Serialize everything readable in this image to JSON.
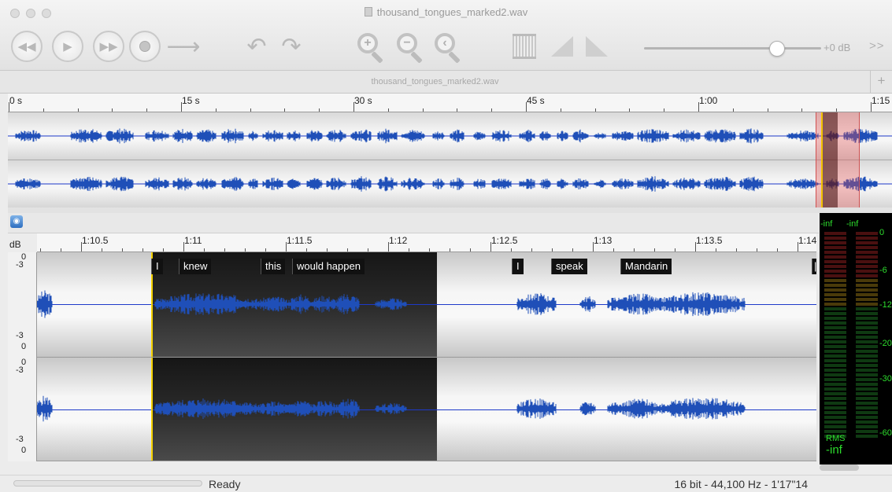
{
  "window": {
    "title": "thousand_tongues_marked2.wav"
  },
  "toolbar": {
    "buttons": [
      {
        "name": "rewind-button",
        "icon": "rewind-icon"
      },
      {
        "name": "play-button",
        "icon": "play-icon"
      },
      {
        "name": "fast-forward-button",
        "icon": "fast-forward-icon"
      },
      {
        "name": "record-button",
        "icon": "record-icon"
      },
      {
        "name": "loop-button",
        "icon": "arrow-right-icon"
      },
      {
        "name": "undo-button",
        "icon": "undo-icon"
      },
      {
        "name": "redo-button",
        "icon": "redo-icon"
      },
      {
        "name": "zoom-in-button",
        "icon": "zoom-in-icon"
      },
      {
        "name": "zoom-out-button",
        "icon": "zoom-out-icon"
      },
      {
        "name": "zoom-fit-button",
        "icon": "zoom-fit-icon"
      },
      {
        "name": "normalize-button",
        "icon": "normalize-icon"
      },
      {
        "name": "fade-in-button",
        "icon": "fade-in-icon"
      },
      {
        "name": "fade-out-button",
        "icon": "fade-out-icon"
      }
    ],
    "gain_slider": {
      "level_fraction": 0.75,
      "label": "+0 dB"
    },
    "more_label": ">>"
  },
  "tab": {
    "title": "thousand_tongues_marked2.wav",
    "add_label": "+"
  },
  "overview_ruler": {
    "labels": [
      "0 s",
      "15 s",
      "30 s",
      "45 s",
      "1:00",
      "1:15"
    ]
  },
  "detail_ruler": {
    "db_label": "dB",
    "labels": [
      "1:10.5",
      "1:11",
      "1:11.5",
      "1:12",
      "1:12.5",
      "1:13",
      "1:13.5",
      "1:14"
    ]
  },
  "channel_scale": {
    "top_zero": "0",
    "top_minus": "-3",
    "bottom_minus": "-3",
    "bottom_zero": "0"
  },
  "markers": [
    {
      "label": "I"
    },
    {
      "label": "knew"
    },
    {
      "label": "this"
    },
    {
      "label": "would happen"
    },
    {
      "label": "I"
    },
    {
      "label": "speak"
    },
    {
      "label": "Mandarin"
    },
    {
      "label": "|"
    }
  ],
  "level_meter": {
    "left_peak": "-inf",
    "right_peak": "-inf",
    "scale": [
      "0",
      "-6",
      "-12",
      "-20",
      "-30",
      "-60"
    ],
    "rms_label": "RMS",
    "rms_value": "-inf"
  },
  "status": {
    "text": "Ready",
    "format": "16 bit - 44,100 Hz - 1'17\"14"
  },
  "colors": {
    "waveform": "#1f4fb8",
    "cursor": "#f5d100",
    "selection": "#e65050",
    "meter_green": "#2ddc2d"
  }
}
